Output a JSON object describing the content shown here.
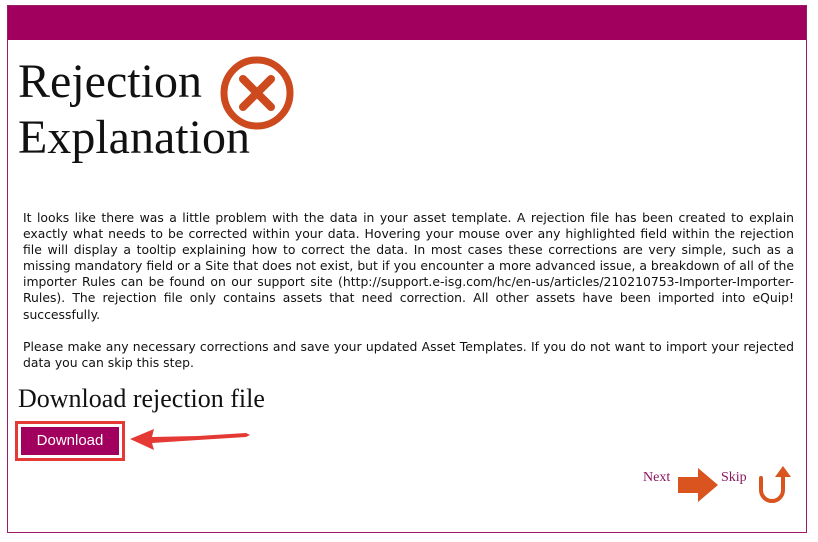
{
  "page": {
    "title_line1": "Rejection",
    "title_line2": "Explanation",
    "paragraph1": "It looks like there was a little problem with the data in your asset template. A rejection file has been created to explain exactly what needs to be corrected within your data. Hovering your mouse over any highlighted field within the rejection file will display a tooltip explaining how to correct the data. In most cases these corrections are very simple, such as a missing mandatory field or a Site that does not exist, but if you encounter a more advanced issue, a breakdown of all of the importer Rules can be found on our support site (http://support.e-isg.com/hc/en-us/articles/210210753-Importer-Importer-Rules). The rejection file only contains assets that need correction. All other assets have been imported into eQuip! successfully.",
    "paragraph2": "Please make any necessary corrections and save your updated Asset Templates. If you do not want to import your rejected data you can skip this step.",
    "section_heading": "Download rejection file",
    "download_label": "Download"
  },
  "nav": {
    "next_label": "Next",
    "skip_label": "Skip"
  },
  "icons": {
    "reject": "reject-x-circle-icon",
    "next": "right-arrow-icon",
    "skip": "u-turn-arrow-icon",
    "annotation": "red-pointer-arrow"
  },
  "colors": {
    "brand": "#a2005e",
    "border": "#9b1a6a",
    "reject_icon": "#cc4a1e",
    "nav_icon": "#d9541e",
    "annotation": "#e53935",
    "link": "#8a1560"
  }
}
